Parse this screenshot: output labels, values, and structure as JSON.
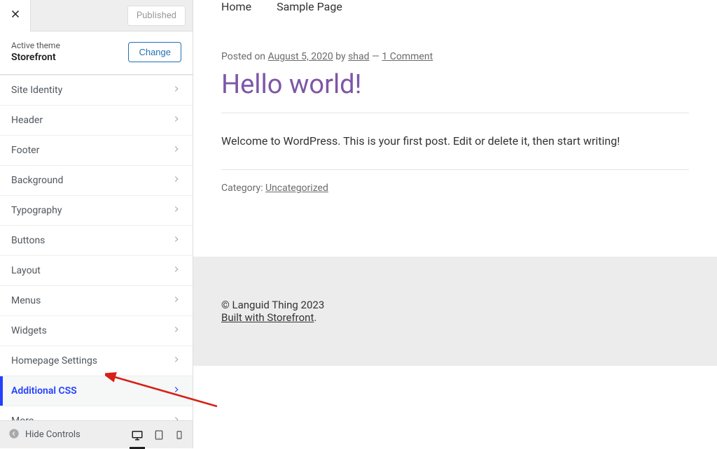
{
  "topbar": {
    "publish_status": "Published"
  },
  "theme": {
    "label": "Active theme",
    "name": "Storefront",
    "change_label": "Change"
  },
  "sections": [
    {
      "label": "Site Identity",
      "active": false
    },
    {
      "label": "Header",
      "active": false
    },
    {
      "label": "Footer",
      "active": false
    },
    {
      "label": "Background",
      "active": false
    },
    {
      "label": "Typography",
      "active": false
    },
    {
      "label": "Buttons",
      "active": false
    },
    {
      "label": "Layout",
      "active": false
    },
    {
      "label": "Menus",
      "active": false
    },
    {
      "label": "Widgets",
      "active": false
    },
    {
      "label": "Homepage Settings",
      "active": false
    },
    {
      "label": "Additional CSS",
      "active": true
    },
    {
      "label": "More",
      "active": false
    }
  ],
  "bottom": {
    "hide_label": "Hide Controls"
  },
  "nav": {
    "items": [
      {
        "label": "Home"
      },
      {
        "label": "Sample Page"
      }
    ]
  },
  "post": {
    "posted_on_label": "Posted on ",
    "date": "August 5, 2020",
    "by_label": " by ",
    "author": "shad",
    "sep": " — ",
    "comments": "1 Comment",
    "title": "Hello world!",
    "body": "Welcome to WordPress. This is your first post. Edit or delete it, then start writing!",
    "category_label": "Category: ",
    "category": "Uncategorized"
  },
  "footer": {
    "copyright": "© Languid Thing 2023",
    "built_with": "Built with Storefront",
    "period": "."
  }
}
